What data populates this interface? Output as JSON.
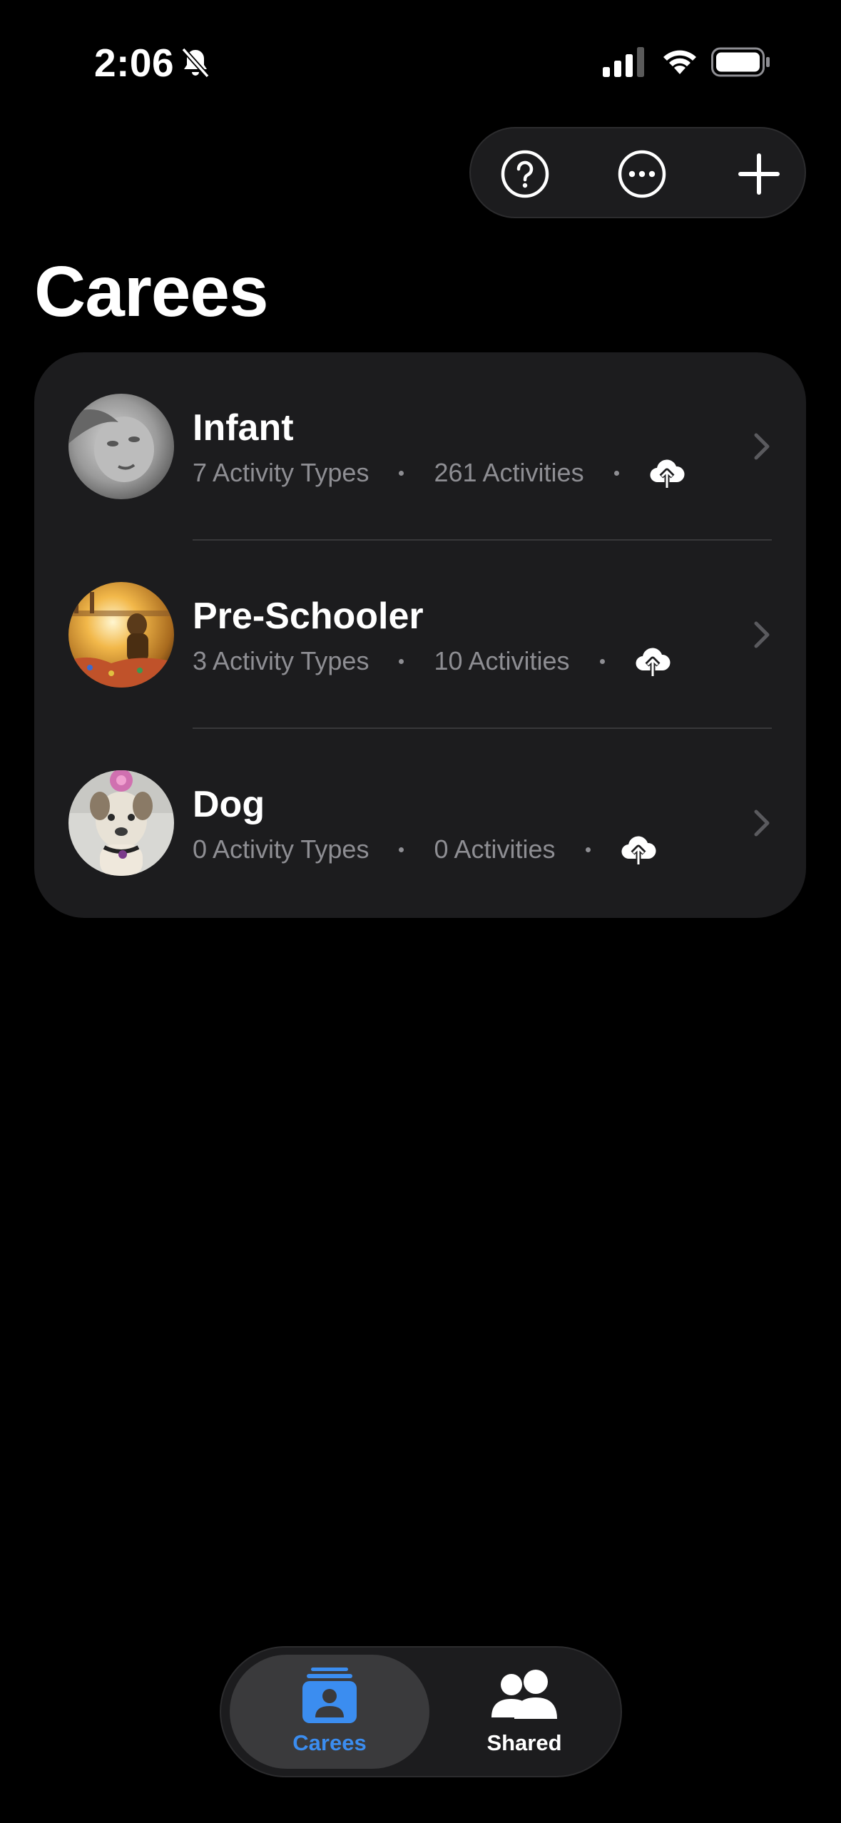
{
  "status_bar": {
    "time": "2:06"
  },
  "toolbar": {
    "help_icon": "question-circle-icon",
    "more_icon": "ellipsis-circle-icon",
    "add_icon": "plus-icon"
  },
  "page": {
    "title": "Carees"
  },
  "carees": [
    {
      "name": "Infant",
      "activity_types": "7 Activity Types",
      "activities": "261 Activities",
      "sync_icon": "cloud-upload-icon"
    },
    {
      "name": "Pre-Schooler",
      "activity_types": "3 Activity Types",
      "activities": "10 Activities",
      "sync_icon": "cloud-upload-icon"
    },
    {
      "name": "Dog",
      "activity_types": "0 Activity Types",
      "activities": "0 Activities",
      "sync_icon": "cloud-upload-icon"
    }
  ],
  "tabbar": {
    "tabs": [
      {
        "label": "Carees",
        "icon": "person-stack-icon",
        "selected": true
      },
      {
        "label": "Shared",
        "icon": "people-icon",
        "selected": false
      }
    ]
  },
  "colors": {
    "accent": "#3b8df0",
    "card_bg": "#1c1c1e",
    "secondary_text": "#8e8e93"
  }
}
